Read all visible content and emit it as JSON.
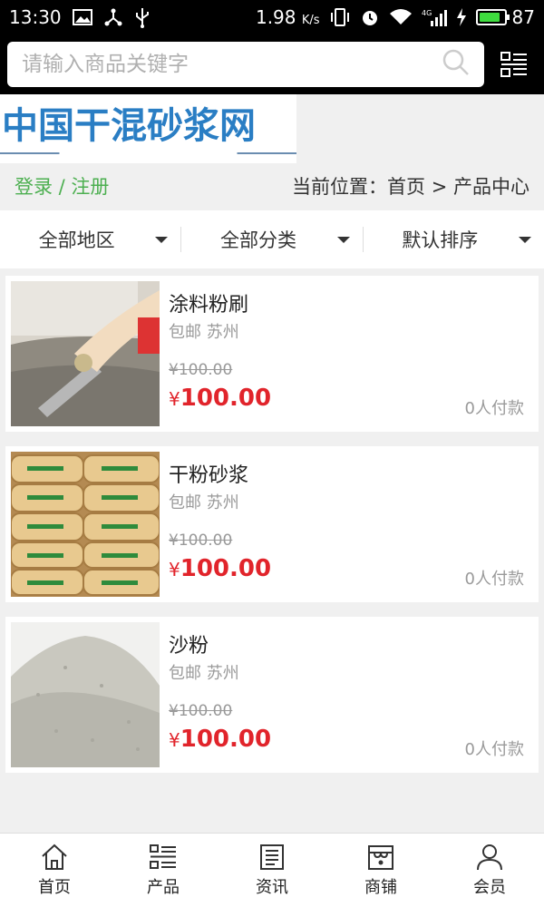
{
  "status_bar": {
    "time": "13:30",
    "speed_value": "1.98",
    "speed_unit": "K/s",
    "network": "4G",
    "battery": "87",
    "battery_level": 0.87
  },
  "search": {
    "placeholder": "请输入商品关键字"
  },
  "logo": {
    "text": "中国干混砂浆网"
  },
  "nav_row": {
    "login": "登录 / 注册",
    "breadcrumb": "当前位置：首页 > 产品中心"
  },
  "filters": [
    {
      "label": "全部地区"
    },
    {
      "label": "全部分类"
    },
    {
      "label": "默认排序"
    }
  ],
  "products": [
    {
      "name": "涂料粉刷",
      "shipping": "包邮 苏州",
      "old_price": "¥100.00",
      "currency": "¥",
      "price": "100.00",
      "paid": "0人付款"
    },
    {
      "name": "干粉砂浆",
      "shipping": "包邮 苏州",
      "old_price": "¥100.00",
      "currency": "¥",
      "price": "100.00",
      "paid": "0人付款"
    },
    {
      "name": "沙粉",
      "shipping": "包邮 苏州",
      "old_price": "¥100.00",
      "currency": "¥",
      "price": "100.00",
      "paid": "0人付款"
    }
  ],
  "bottom_nav": [
    {
      "label": "首页",
      "icon": "home-icon"
    },
    {
      "label": "产品",
      "icon": "grid-list-icon"
    },
    {
      "label": "资讯",
      "icon": "news-icon"
    },
    {
      "label": "商铺",
      "icon": "shop-icon"
    },
    {
      "label": "会员",
      "icon": "user-icon"
    }
  ]
}
